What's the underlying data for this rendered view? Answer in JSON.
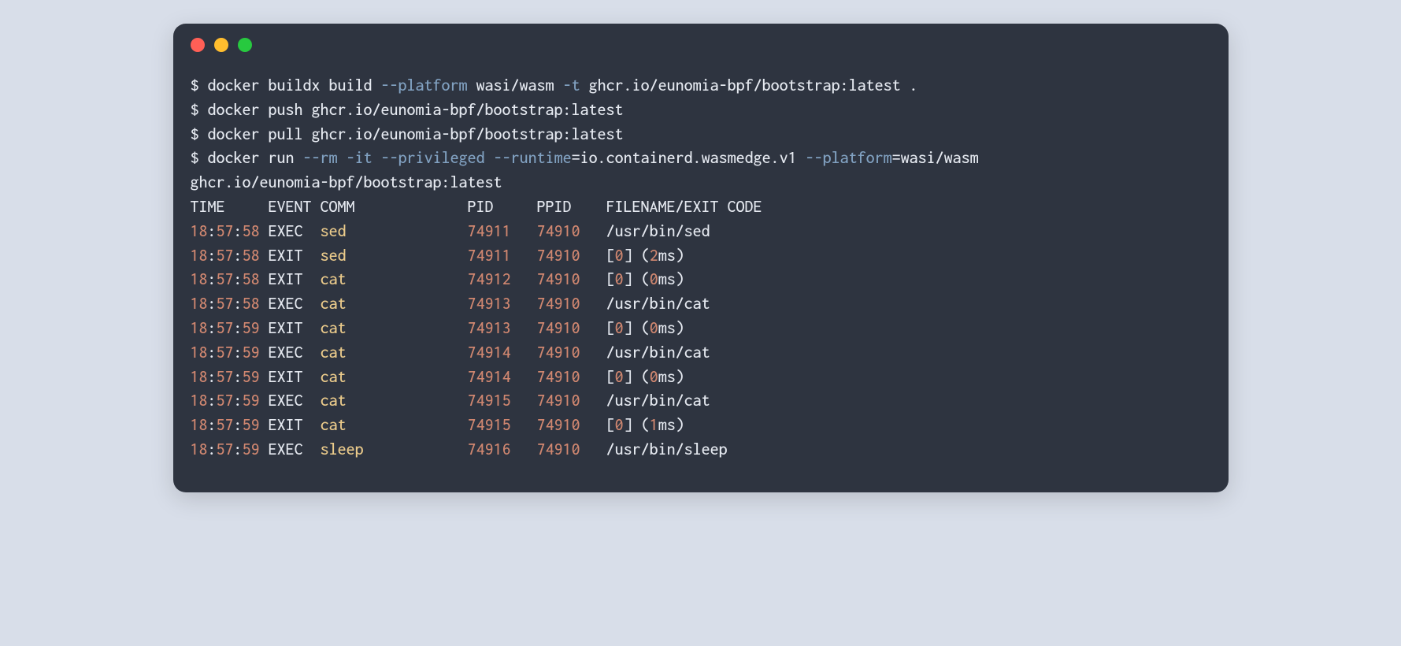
{
  "commands": [
    {
      "prompt": "$ ",
      "segments": [
        {
          "t": "docker buildx build ",
          "c": "cmd"
        },
        {
          "t": "--platform",
          "c": "flag"
        },
        {
          "t": " wasi/wasm ",
          "c": "cmd"
        },
        {
          "t": "-t",
          "c": "flag"
        },
        {
          "t": " ghcr.io/eunomia-bpf/bootstrap:latest .",
          "c": "cmd"
        }
      ]
    },
    {
      "prompt": "$ ",
      "segments": [
        {
          "t": "docker push ghcr.io/eunomia-bpf/bootstrap:latest",
          "c": "cmd"
        }
      ]
    },
    {
      "prompt": "$ ",
      "segments": [
        {
          "t": "docker pull ghcr.io/eunomia-bpf/bootstrap:latest",
          "c": "cmd"
        }
      ]
    },
    {
      "prompt": "$ ",
      "segments": [
        {
          "t": "docker run ",
          "c": "cmd"
        },
        {
          "t": "--rm",
          "c": "flag"
        },
        {
          "t": " ",
          "c": "cmd"
        },
        {
          "t": "-it",
          "c": "flag"
        },
        {
          "t": " ",
          "c": "cmd"
        },
        {
          "t": "--privileged",
          "c": "flag"
        },
        {
          "t": " ",
          "c": "cmd"
        },
        {
          "t": "--runtime",
          "c": "flag"
        },
        {
          "t": "=io.containerd.wasmedge.v1 ",
          "c": "cmd"
        },
        {
          "t": "--platform",
          "c": "flag"
        },
        {
          "t": "=wasi/wasm",
          "c": "cmd"
        }
      ]
    },
    {
      "prompt": "",
      "segments": [
        {
          "t": "ghcr.io/eunomia-bpf/bootstrap:latest",
          "c": "cmd"
        }
      ]
    }
  ],
  "table": {
    "header": {
      "time": "TIME",
      "event": "EVENT",
      "comm": "COMM",
      "pid": "PID",
      "ppid": "PPID",
      "filename": "FILENAME/EXIT CODE"
    },
    "rows": [
      {
        "h": "18",
        "m": "57",
        "s": "58",
        "event": "EXEC",
        "comm": "sed",
        "pid": "74911",
        "ppid": "74910",
        "detail": {
          "type": "path",
          "value": "/usr/bin/sed"
        }
      },
      {
        "h": "18",
        "m": "57",
        "s": "58",
        "event": "EXIT",
        "comm": "sed",
        "pid": "74911",
        "ppid": "74910",
        "detail": {
          "type": "exit",
          "code": "0",
          "dur_n": "2",
          "dur_u": "ms"
        }
      },
      {
        "h": "18",
        "m": "57",
        "s": "58",
        "event": "EXIT",
        "comm": "cat",
        "pid": "74912",
        "ppid": "74910",
        "detail": {
          "type": "exit",
          "code": "0",
          "dur_n": "0",
          "dur_u": "ms"
        }
      },
      {
        "h": "18",
        "m": "57",
        "s": "58",
        "event": "EXEC",
        "comm": "cat",
        "pid": "74913",
        "ppid": "74910",
        "detail": {
          "type": "path",
          "value": "/usr/bin/cat"
        }
      },
      {
        "h": "18",
        "m": "57",
        "s": "59",
        "event": "EXIT",
        "comm": "cat",
        "pid": "74913",
        "ppid": "74910",
        "detail": {
          "type": "exit",
          "code": "0",
          "dur_n": "0",
          "dur_u": "ms"
        }
      },
      {
        "h": "18",
        "m": "57",
        "s": "59",
        "event": "EXEC",
        "comm": "cat",
        "pid": "74914",
        "ppid": "74910",
        "detail": {
          "type": "path",
          "value": "/usr/bin/cat"
        }
      },
      {
        "h": "18",
        "m": "57",
        "s": "59",
        "event": "EXIT",
        "comm": "cat",
        "pid": "74914",
        "ppid": "74910",
        "detail": {
          "type": "exit",
          "code": "0",
          "dur_n": "0",
          "dur_u": "ms"
        }
      },
      {
        "h": "18",
        "m": "57",
        "s": "59",
        "event": "EXEC",
        "comm": "cat",
        "pid": "74915",
        "ppid": "74910",
        "detail": {
          "type": "path",
          "value": "/usr/bin/cat"
        }
      },
      {
        "h": "18",
        "m": "57",
        "s": "59",
        "event": "EXIT",
        "comm": "cat",
        "pid": "74915",
        "ppid": "74910",
        "detail": {
          "type": "exit",
          "code": "0",
          "dur_n": "1",
          "dur_u": "ms"
        }
      },
      {
        "h": "18",
        "m": "57",
        "s": "59",
        "event": "EXEC",
        "comm": "sleep",
        "pid": "74916",
        "ppid": "74910",
        "detail": {
          "type": "path",
          "value": "/usr/bin/sleep"
        }
      }
    ]
  }
}
